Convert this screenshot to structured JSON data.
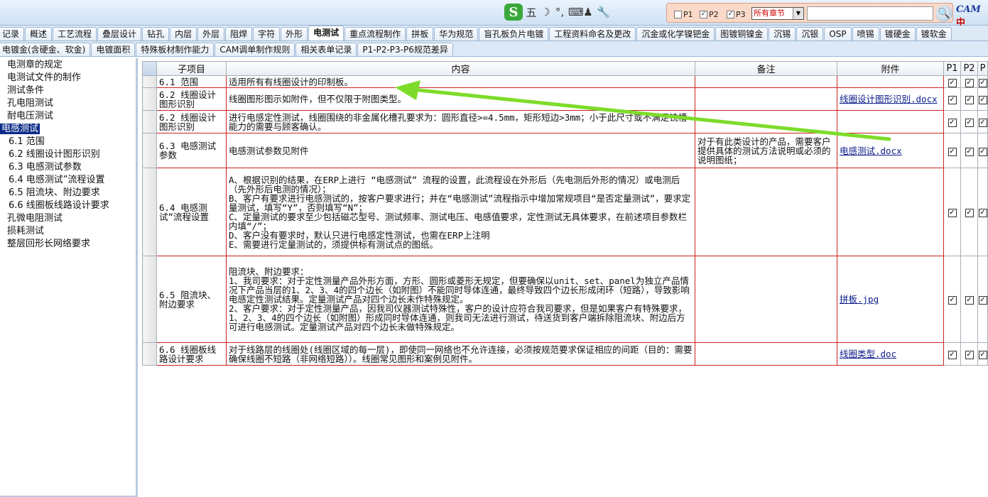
{
  "toolbar": {
    "ime_logo": "S",
    "ime_mode": "五",
    "ime_moon": "☽",
    "ime_punct": "°,",
    "ime_keyboard": "⌨",
    "ime_user": "♟",
    "ime_tool": "🔧",
    "checkboxes": [
      {
        "label": "P1",
        "checked": ""
      },
      {
        "label": "P2",
        "checked": "✓"
      },
      {
        "label": "P3",
        "checked": "✓"
      }
    ],
    "chapter_select": "所有章节",
    "search_value": "",
    "search_icon": "🔍",
    "cam_logo": "CAM",
    "cam_suffix": "中",
    "accent": "#0a2a86"
  },
  "tabs_row1": [
    "记录",
    "概述",
    "工艺流程",
    "叠层设计",
    "钻孔",
    "内层",
    "外层",
    "阻焊",
    "字符",
    "外形",
    "电测试",
    "重点流程制作",
    "拼板",
    "华为规范",
    "盲孔板负片电镀",
    "工程资料命名及更改",
    "沉金或化学镍钯金",
    "图镀铜镍金",
    "沉锡",
    "沉银",
    "OSP",
    "喷锡",
    "镀硬金",
    "镀软金"
  ],
  "tabs_row2": [
    "电镀金(含硬金、软金)",
    "电镀面积",
    "特殊板材制作能力",
    "CAM调单制作规则",
    "相关表单记录",
    "P1-P2-P3-P6规范差异"
  ],
  "active_tab": "电测试",
  "tree": [
    {
      "label": "电测章的规定",
      "sub": false,
      "sel": false
    },
    {
      "label": "电测试文件的制作",
      "sub": false,
      "sel": false
    },
    {
      "label": "测试条件",
      "sub": false,
      "sel": false
    },
    {
      "label": "孔电阻测试",
      "sub": false,
      "sel": false
    },
    {
      "label": "耐电压测试",
      "sub": false,
      "sel": false
    },
    {
      "label": "电感测试",
      "sub": false,
      "sel": true
    },
    {
      "label": "6.1 范围",
      "sub": true,
      "sel": false
    },
    {
      "label": "6.2 线圈设计图形识别",
      "sub": true,
      "sel": false
    },
    {
      "label": "6.3 电感测试参数",
      "sub": true,
      "sel": false
    },
    {
      "label": "6.4 电感测试”流程设置",
      "sub": true,
      "sel": false
    },
    {
      "label": "6.5 阻流块、附边要求",
      "sub": true,
      "sel": false
    },
    {
      "label": "6.6 线圈板线路设计要求",
      "sub": true,
      "sel": false
    },
    {
      "label": "孔微电阻测试",
      "sub": false,
      "sel": false
    },
    {
      "label": "损耗测试",
      "sub": false,
      "sel": false
    },
    {
      "label": "整层回形长网络要求",
      "sub": false,
      "sel": false
    }
  ],
  "grid": {
    "headers": {
      "sub": "子项目",
      "content": "内容",
      "note": "备注",
      "attach": "附件",
      "p1": "P1",
      "p2": "P2",
      "p3": "P"
    },
    "check_glyph": "✓",
    "rows": [
      {
        "sub": "6.1 范围",
        "content": "适用所有有线圈设计的印制板。",
        "note": "",
        "attach": ""
      },
      {
        "sub": "6.2 线圈设计图形识别",
        "content": "线圈图形图示如附件，但不仅限于附图类型。",
        "note": "",
        "attach": "线圈设计图形识别.docx"
      },
      {
        "sub": "6.2 线圈设计图形识别",
        "content": "进行电感定性测试，线圈围绕的非金属化槽孔要求为：圆形直径>=4.5mm，矩形短边>3mm；小于此尺寸或不满足铣槽能力的需要与顾客确认。",
        "note": "",
        "attach": ""
      },
      {
        "sub": "6.3 电感测试参数",
        "content": "电感测试参数见附件",
        "note": "对于有此类设计的产品，需要客户提供具体的测试方法说明或必须的说明图纸；",
        "attach": "电感测试.docx"
      },
      {
        "sub": "6.4 电感测试”流程设置",
        "content": "A、根据识别的结果，在ERP上进行 “电感测试” 流程的设置，此流程设在外形后（先电测后外形的情况）或电测后（先外形后电测的情况）；\nB、客户有要求进行电感测试的，按客户要求进行；并在“电感测试”流程指示中增加常规项目“是否定量测试”，要求定量测试，填写“Y”，否则填写“N”；\nC、定量测试的要求至少包括磁芯型号、测试频率、测试电压、电感值要求，定性测试无具体要求，在前述项目参数栏内填“/”；\nD、客户没有要求时，默认只进行电感定性测试，也需在ERP上注明\nE、需要进行定量测试的，须提供标有测试点的图纸。",
        "note": "",
        "attach": ""
      },
      {
        "sub": "6.5 阻流块、附边要求",
        "content": "阻流块、附边要求：\n1、我司要求：对于定性测量产品外形方面，方形、圆形或菱形无规定，但要确保以unit、set、panel为独立产品情况下产品当层的1、2、3、4的四个边长（如附图）不能同时导体连通，最终导致四个边长形成闭环（短路），导致影响电感定性测试结果。定量测试产品对四个边长未作特殊规定。\n2、客户要求：对于定性测量产品，因我司仪器测试特殊性，客户的设计应符合我司要求，但是如果客户有特殊要求，1、2、3、4的四个边长（如附图）形成同时导体连通，则我司无法进行测试，待送货到客户端拆除阻流块、附边后方可进行电感测试。定量测试产品对四个边长未做特殊规定。",
        "note": "",
        "attach": "拼板.jpg"
      },
      {
        "sub": "6.6 线圈板线路设计要求",
        "content": "对于线路层的线圈处(线圈区域的每一层)，即使同一网络也不允许连接，必须按规范要求保证相应的间距（目的：需要确保线圈不短路（非网络短路））。线圈常见图形和案例见附件。",
        "note": "",
        "attach": "线圈类型.doc"
      }
    ]
  },
  "annotation": {
    "color": "#7ddc2a"
  }
}
